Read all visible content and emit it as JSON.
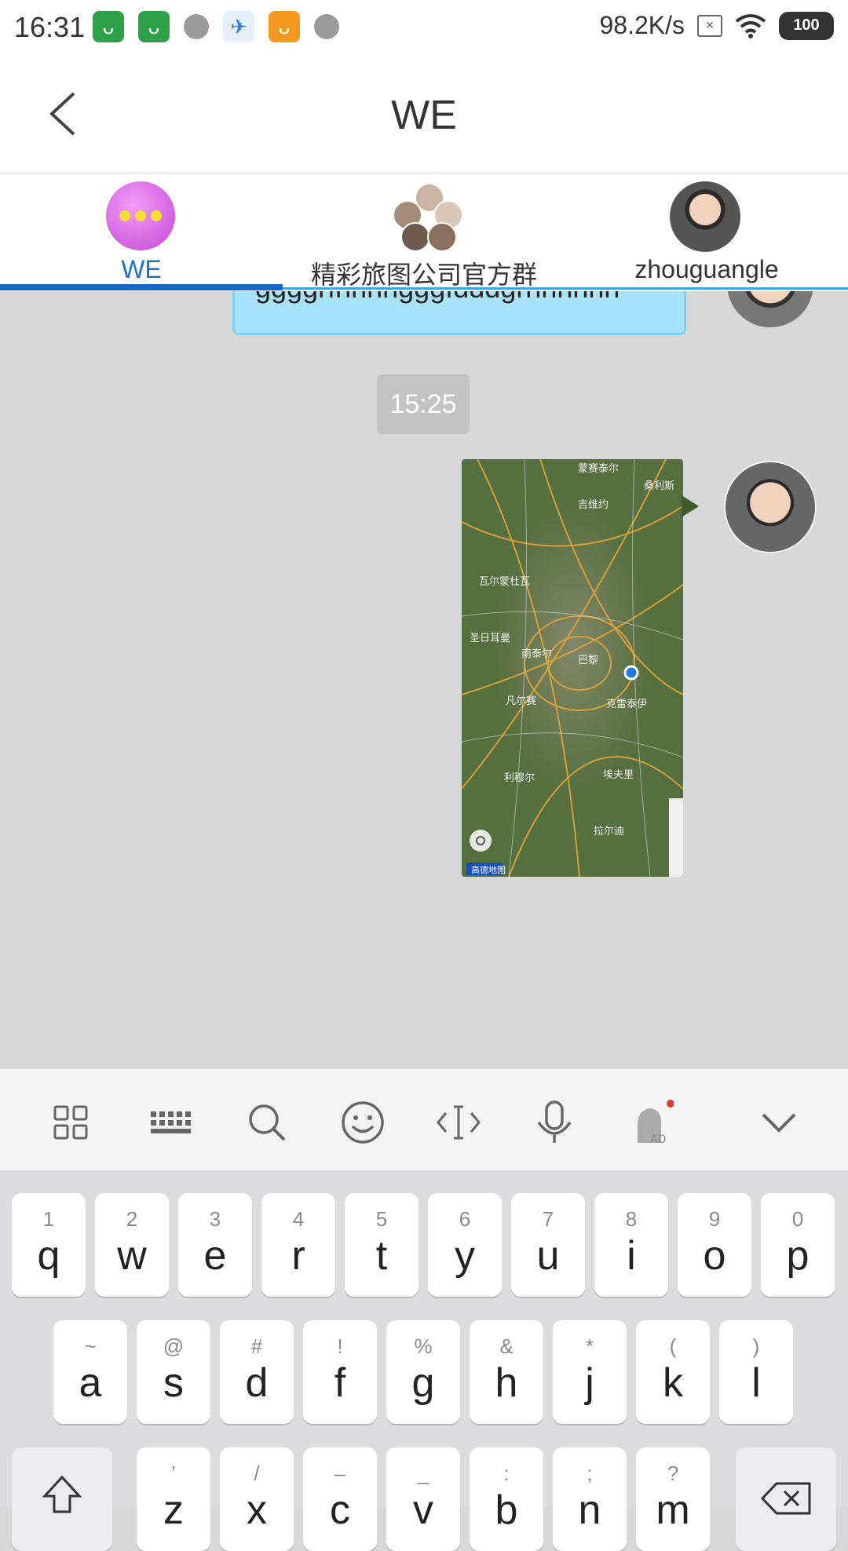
{
  "status_bar": {
    "time": "16:31",
    "network_speed": "98.2K/s",
    "battery": "100"
  },
  "header": {
    "title": "WE"
  },
  "tabs": [
    {
      "label": "WE",
      "active": true
    },
    {
      "label": "精彩旅图公司官方群",
      "active": false
    },
    {
      "label": "zhouguangle",
      "active": false
    }
  ],
  "chat": {
    "prev_message_text": "ggggrfhhhhgggfdddgrhhhhhh",
    "timestamp": "15:25",
    "map_labels": [
      "蒙赛泰尔",
      "吉维约",
      "桑利斯",
      "瓦尔蒙杜瓦",
      "巴黎",
      "南泰尔",
      "凡尔赛",
      "克雷泰伊",
      "埃夫里",
      "拉尔迪",
      "利穆尔",
      "圣日耳曼",
      "高德地图"
    ]
  },
  "keyboard": {
    "toolbar_icons": [
      "grid-icon",
      "keyboard-icon",
      "search-icon",
      "emoji-icon",
      "cursor-icon",
      "microphone-icon",
      "ad-avatar-icon",
      "chevron-down-icon"
    ],
    "row1": [
      {
        "sub": "1",
        "key": "q"
      },
      {
        "sub": "2",
        "key": "w"
      },
      {
        "sub": "3",
        "key": "e"
      },
      {
        "sub": "4",
        "key": "r"
      },
      {
        "sub": "5",
        "key": "t"
      },
      {
        "sub": "6",
        "key": "y"
      },
      {
        "sub": "7",
        "key": "u"
      },
      {
        "sub": "8",
        "key": "i"
      },
      {
        "sub": "9",
        "key": "o"
      },
      {
        "sub": "0",
        "key": "p"
      }
    ],
    "row2": [
      {
        "sub": "~",
        "key": "a"
      },
      {
        "sub": "@",
        "key": "s"
      },
      {
        "sub": "#",
        "key": "d"
      },
      {
        "sub": "!",
        "key": "f"
      },
      {
        "sub": "%",
        "key": "g"
      },
      {
        "sub": "&",
        "key": "h"
      },
      {
        "sub": "*",
        "key": "j"
      },
      {
        "sub": "(",
        "key": "k"
      },
      {
        "sub": ")",
        "key": "l"
      }
    ],
    "row3": [
      {
        "sub": "’",
        "key": "z"
      },
      {
        "sub": "/",
        "key": "x"
      },
      {
        "sub": "–",
        "key": "c"
      },
      {
        "sub": "_",
        "key": "v"
      },
      {
        "sub": ":",
        "key": "b"
      },
      {
        "sub": ";",
        "key": "n"
      },
      {
        "sub": "?",
        "key": "m"
      }
    ],
    "colors": {
      "accent": "#1667c6",
      "bubble": "#a9e3fb"
    }
  }
}
